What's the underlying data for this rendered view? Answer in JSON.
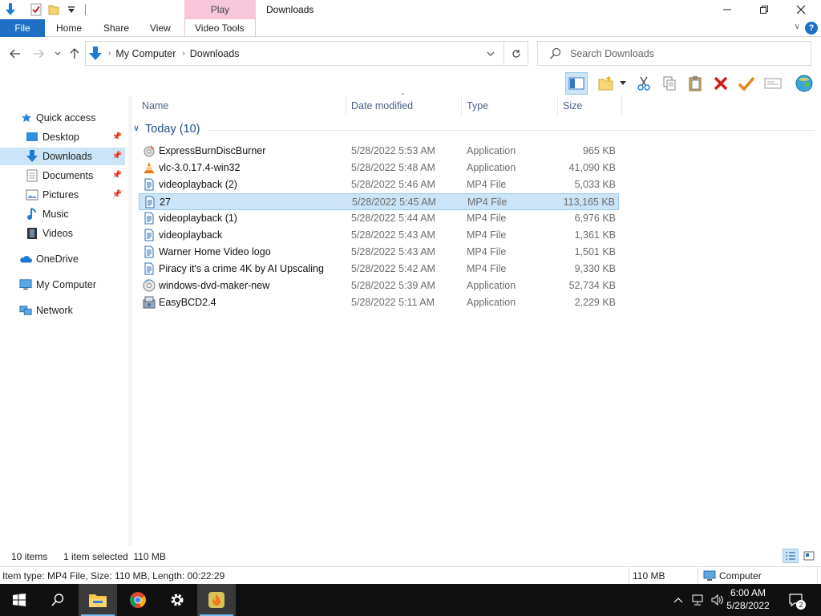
{
  "window": {
    "title": "Downloads",
    "context_tab": "Play"
  },
  "ribbon": {
    "tabs": [
      "File",
      "Home",
      "Share",
      "View",
      "Video Tools"
    ],
    "help": "?"
  },
  "address": {
    "crumbs": [
      "My Computer",
      "Downloads"
    ]
  },
  "search": {
    "placeholder": "Search Downloads"
  },
  "sidebar": {
    "items": [
      {
        "label": "Quick access",
        "icon": "star-icon"
      },
      {
        "label": "Desktop",
        "icon": "desktop-icon"
      },
      {
        "label": "Downloads",
        "icon": "download-arrow-icon"
      },
      {
        "label": "Documents",
        "icon": "document-icon"
      },
      {
        "label": "Pictures",
        "icon": "pictures-icon"
      },
      {
        "label": "Music",
        "icon": "music-note-icon"
      },
      {
        "label": "Videos",
        "icon": "film-icon"
      },
      {
        "label": "OneDrive",
        "icon": "cloud-icon"
      },
      {
        "label": "My Computer",
        "icon": "computer-icon"
      },
      {
        "label": "Network",
        "icon": "network-icon"
      }
    ]
  },
  "columns": {
    "name": "Name",
    "date": "Date modified",
    "type": "Type",
    "size": "Size"
  },
  "group": {
    "label": "Today (10)"
  },
  "files": [
    {
      "name": "ExpressBurnDiscBurner",
      "date": "5/28/2022 5:53 AM",
      "type": "Application",
      "size": "965 KB",
      "icon": "app-burn-icon"
    },
    {
      "name": "vlc-3.0.17.4-win32",
      "date": "5/28/2022 5:48 AM",
      "type": "Application",
      "size": "41,090 KB",
      "icon": "vlc-cone-icon"
    },
    {
      "name": "videoplayback (2)",
      "date": "5/28/2022 5:46 AM",
      "type": "MP4 File",
      "size": "5,033 KB",
      "icon": "file-icon"
    },
    {
      "name": "27",
      "date": "5/28/2022 5:45 AM",
      "type": "MP4 File",
      "size": "113,165 KB",
      "icon": "file-icon"
    },
    {
      "name": "videoplayback (1)",
      "date": "5/28/2022 5:44 AM",
      "type": "MP4 File",
      "size": "6,976 KB",
      "icon": "file-icon"
    },
    {
      "name": "videoplayback",
      "date": "5/28/2022 5:43 AM",
      "type": "MP4 File",
      "size": "1,361 KB",
      "icon": "file-icon"
    },
    {
      "name": "Warner Home Video logo",
      "date": "5/28/2022 5:43 AM",
      "type": "MP4 File",
      "size": "1,501 KB",
      "icon": "file-icon"
    },
    {
      "name": "Piracy it's a crime 4K by AI Upscaling",
      "date": "5/28/2022 5:42 AM",
      "type": "MP4 File",
      "size": "9,330 KB",
      "icon": "file-icon"
    },
    {
      "name": "windows-dvd-maker-new",
      "date": "5/28/2022 5:39 AM",
      "type": "Application",
      "size": "52,734 KB",
      "icon": "dvd-app-icon"
    },
    {
      "name": "EasyBCD2.4",
      "date": "5/28/2022 5:11 AM",
      "type": "Application",
      "size": "2,229 KB",
      "icon": "installer-icon"
    }
  ],
  "selected_index": 3,
  "status": {
    "count": "10 items",
    "selection": "1 item selected  110 MB",
    "details": "Item type: MP4 File, Size: 110 MB, Length: 00:22:29",
    "size": "110 MB",
    "location": "Computer"
  },
  "taskbar": {
    "time": "6:00 AM",
    "date": "5/28/2022",
    "notifications": "2"
  },
  "colors": {
    "accent": "#1f6fc5",
    "selection": "#cce4f7",
    "selection_border": "#99c9ef",
    "group_text": "#1e4e8c",
    "context_tab": "#f7c6d9"
  }
}
